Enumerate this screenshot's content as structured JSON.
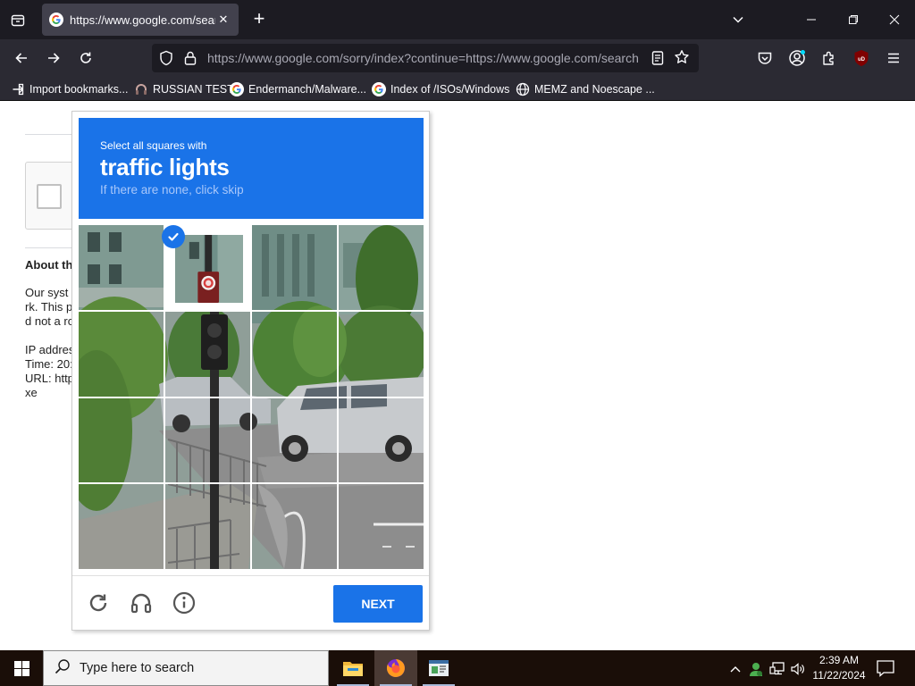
{
  "browser": {
    "tab": {
      "title": "https://www.google.com/search"
    },
    "url": {
      "host": "https://www.google.com",
      "path": "/sorry/index?continue=https://www.google.com/search"
    },
    "bookmarks": [
      {
        "label": "Import bookmarks...",
        "icon": "import-icon"
      },
      {
        "label": "RUSSIAN TEST",
        "icon": "headset-favicon"
      },
      {
        "label": "Endermanch/Malware...",
        "icon": "google-favicon"
      },
      {
        "label": "Index of /ISOs/Windows",
        "icon": "google-favicon"
      },
      {
        "label": "MEMZ and Noescape ...",
        "icon": "globe-icon"
      }
    ]
  },
  "page": {
    "about_heading": "About th",
    "lines": [
      "Our syst",
      "rk. This p",
      "d not a ro",
      "IP addres",
      "Time: 20:",
      "URL: http",
      "xe"
    ]
  },
  "captcha": {
    "instruction": "Select all squares with",
    "target": "traffic lights",
    "hint": "If there are none, click skip",
    "next_label": "NEXT",
    "selected_tiles": [
      [
        0,
        1
      ]
    ],
    "colors": {
      "header": "#1a73e8",
      "button": "#1a73e8"
    }
  },
  "taskbar": {
    "search_placeholder": "Type here to search",
    "time": "2:39 AM",
    "date": "11/22/2024"
  }
}
